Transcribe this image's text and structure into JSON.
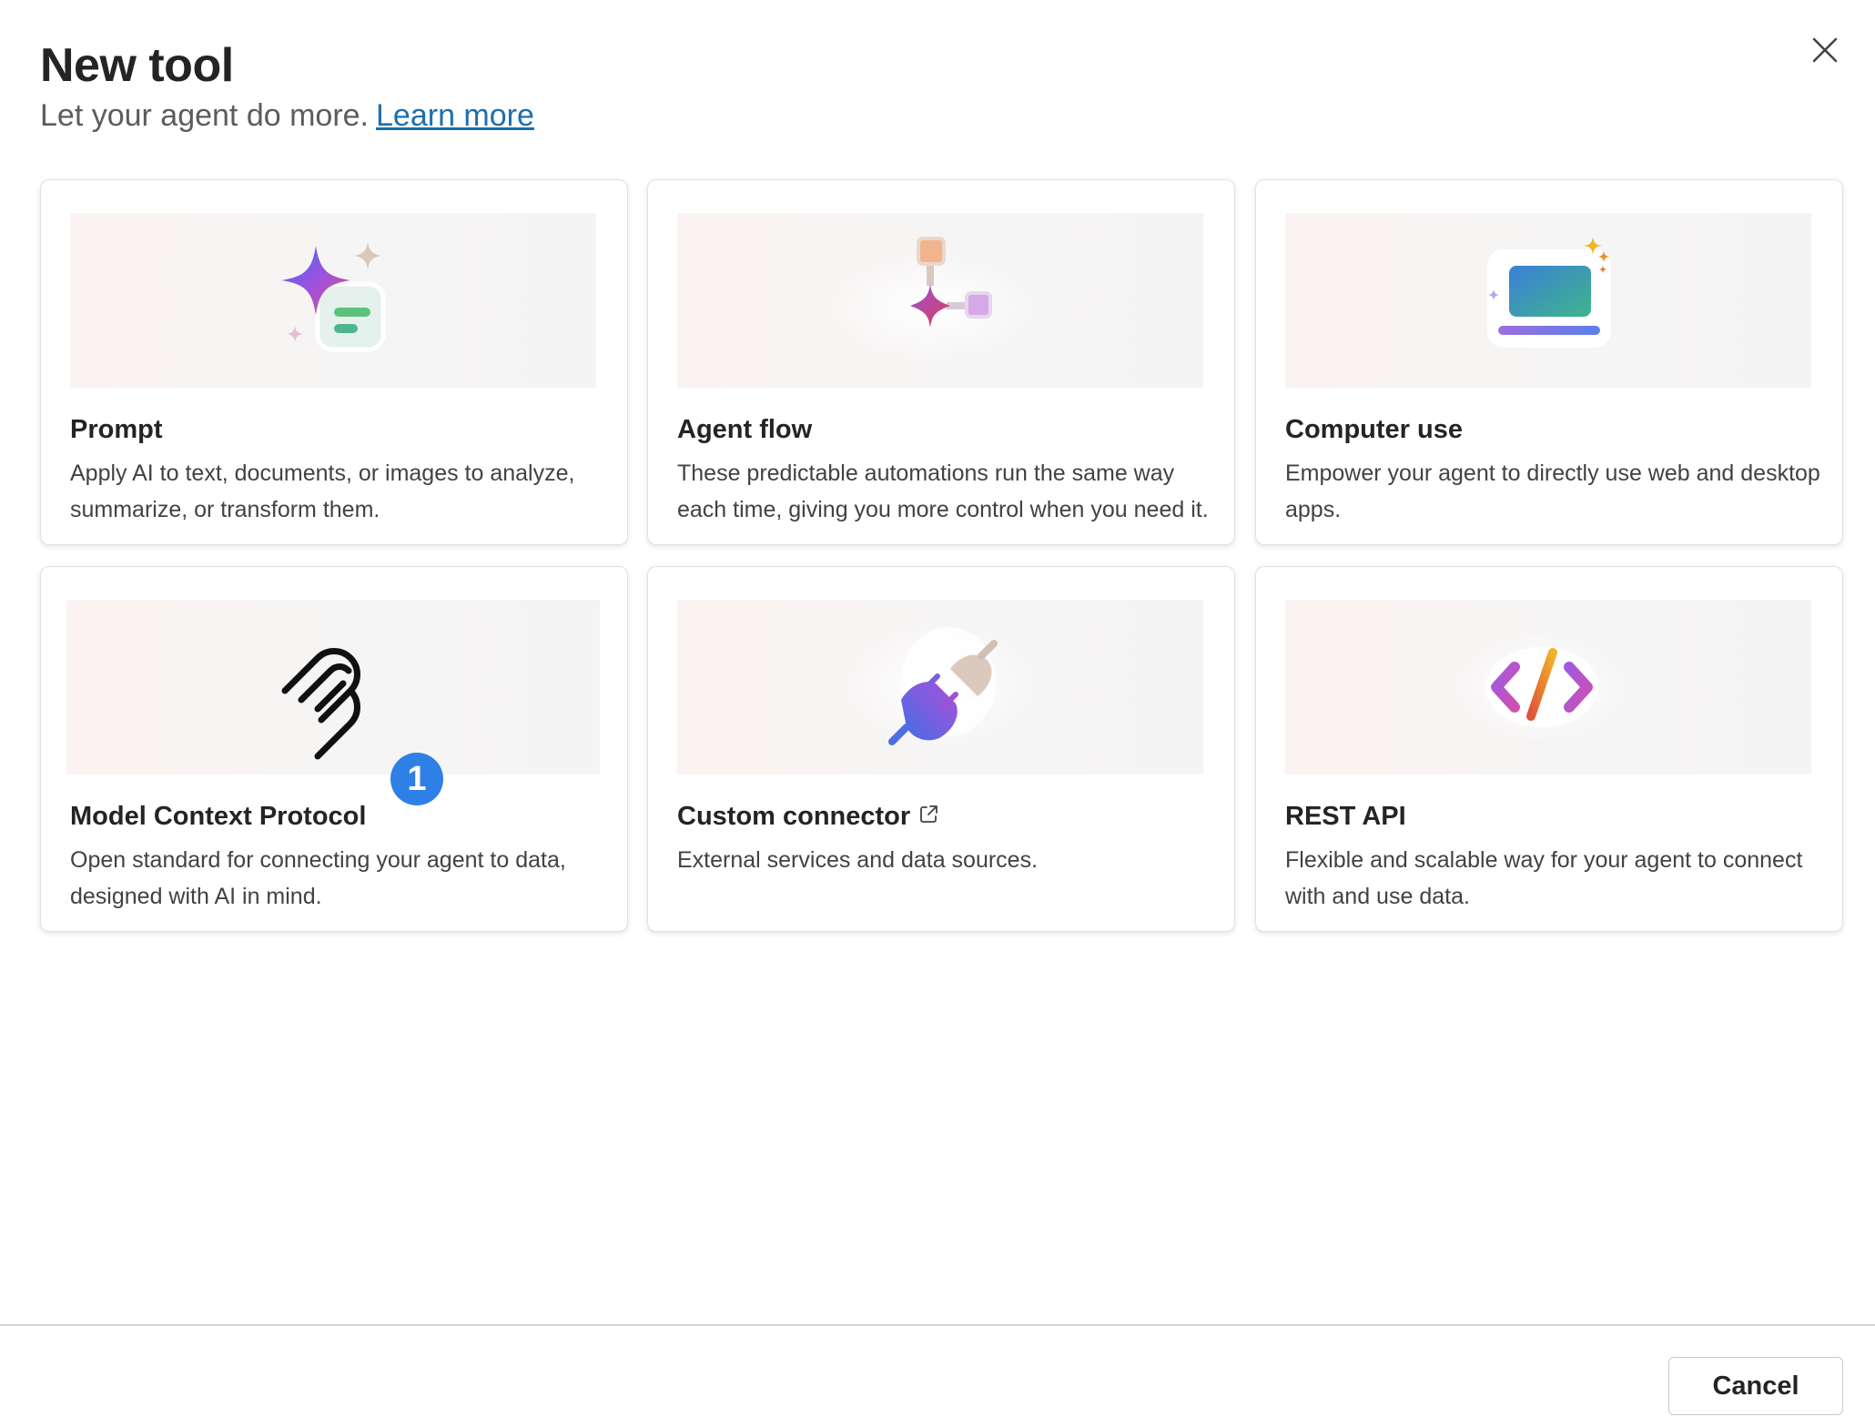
{
  "dialog": {
    "title": "New tool",
    "subtitle": "Let your agent do more.",
    "learn_more": "Learn more",
    "close_icon": "close-icon"
  },
  "tools": [
    {
      "name": "Prompt",
      "description": "Apply AI to text, documents, or images to analyze, summarize, or transform them.",
      "icon": "sparkle-prompt-icon"
    },
    {
      "name": "Agent flow",
      "description": "These predictable automations run the same way each time, giving you more control when you need it.",
      "icon": "agent-flow-icon"
    },
    {
      "name": "Computer use",
      "description": "Empower your agent to directly use web and desktop apps.",
      "icon": "computer-use-icon"
    },
    {
      "name": "Model Context Protocol",
      "description": "Open standard for connecting your agent to data, designed with AI in mind.",
      "icon": "mcp-icon"
    },
    {
      "name": "Custom connector",
      "description": "External services and data sources.",
      "icon": "plug-connector-icon",
      "external_link_icon": "open-in-new-icon"
    },
    {
      "name": "REST API",
      "description": "Flexible and scalable way for your agent to connect with and use data.",
      "icon": "code-brackets-icon"
    }
  ],
  "badge": {
    "value": "1",
    "color": "#2e80e6"
  },
  "footer": {
    "cancel_label": "Cancel"
  },
  "colors": {
    "link": "#1c6fb0",
    "title": "#242424",
    "subtitle": "#5c5c5c"
  }
}
